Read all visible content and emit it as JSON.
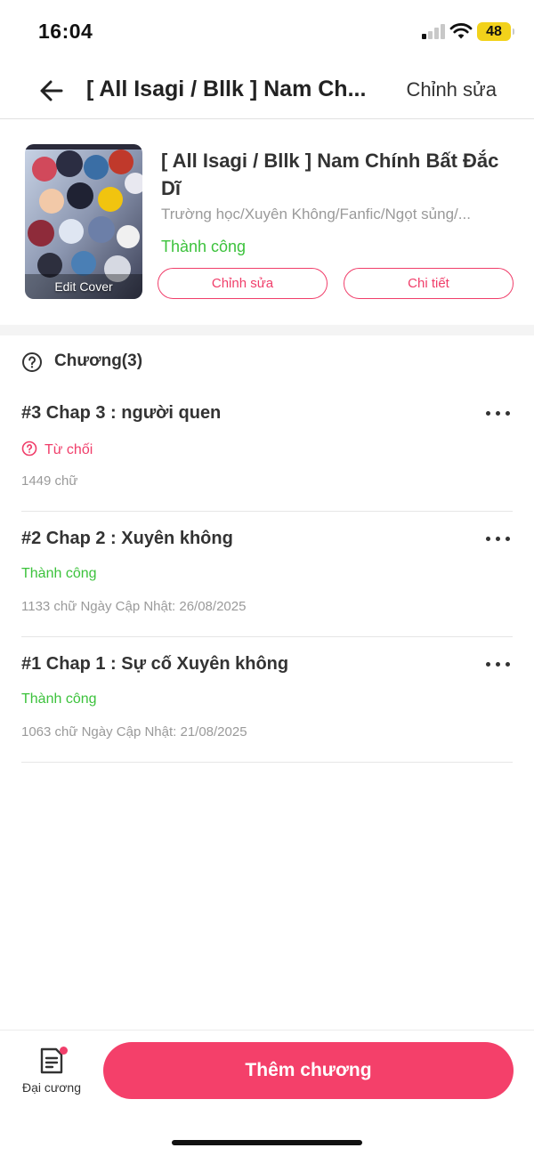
{
  "status_bar": {
    "time": "16:04",
    "battery": "48"
  },
  "nav": {
    "title": "[ All Isagi / Bllk ] Nam Ch...",
    "edit_label": "Chỉnh sửa",
    "back_icon": "arrow-left-icon"
  },
  "book": {
    "cover_label": "Edit Cover",
    "title": "[ All Isagi / Bllk ] Nam Chính Bất Đắc Dĩ",
    "genres": "Trường học/Xuyên Không/Fanfic/Ngọt sủng/...",
    "status": "Thành công",
    "edit_button": "Chỉnh sửa",
    "detail_button": "Chi tiết"
  },
  "chapters_section": {
    "title": "Chương(3)",
    "icon": "help-circle-icon",
    "items": [
      {
        "title": "#3 Chap 3 : người quen",
        "status": "Từ chối",
        "status_type": "reject",
        "meta": "1449 chữ"
      },
      {
        "title": "#2 Chap 2 : Xuyên không",
        "status": "Thành công",
        "status_type": "ok",
        "meta": "1133 chữ Ngày Cập Nhật: 26/08/2025"
      },
      {
        "title": "#1 Chap 1 : Sự cố Xuyên không",
        "status": "Thành công",
        "status_type": "ok",
        "meta": "1063 chữ Ngày Cập Nhật: 21/08/2025"
      }
    ]
  },
  "bottom_bar": {
    "outline_label": "Đại cương",
    "add_chapter_label": "Thêm chương"
  },
  "colors": {
    "accent": "#f4406a",
    "success": "#3cc23c",
    "muted": "#9a9a9a"
  }
}
